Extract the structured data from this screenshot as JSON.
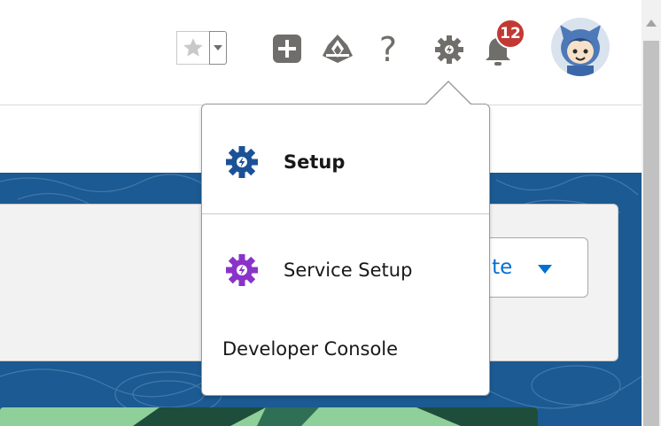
{
  "header": {
    "favorites": {
      "star_icon": "star-icon",
      "caret_icon": "chevron-down-icon"
    },
    "icons": [
      "add-icon",
      "trailhead-icon",
      "help-icon",
      "setup-gear-icon",
      "bell-icon"
    ],
    "help_glyph": "?",
    "notification_count": "12",
    "avatar_icon": "avatar-astro-icon"
  },
  "page": {
    "create_button_label": "ate"
  },
  "setup_menu": {
    "items": [
      {
        "label": "Setup",
        "icon": "setup-gear-icon",
        "icon_color": "#1b5297"
      },
      {
        "label": "Service Setup",
        "icon": "service-setup-gear-icon",
        "icon_color": "#8a33c9"
      },
      {
        "label": "Developer Console"
      }
    ]
  },
  "colors": {
    "brand_blue": "#0070d2",
    "band_blue": "#1b5a92",
    "badge_red": "#c23934",
    "icon_gray": "#706e6b"
  }
}
